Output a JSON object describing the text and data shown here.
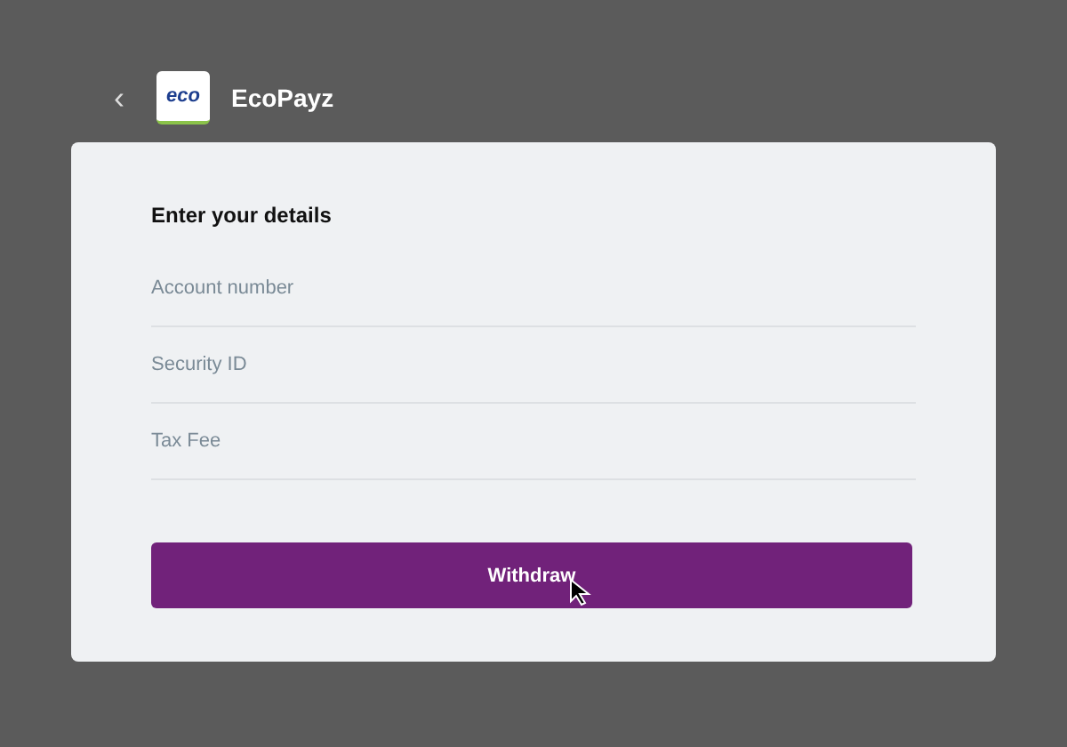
{
  "header": {
    "back": "‹",
    "logo_text": "eco",
    "title": "EcoPayz"
  },
  "form": {
    "heading": "Enter your details",
    "fields": [
      {
        "placeholder": "Account number"
      },
      {
        "placeholder": "Security ID"
      },
      {
        "placeholder": "Tax Fee"
      }
    ],
    "button": "Withdraw"
  }
}
